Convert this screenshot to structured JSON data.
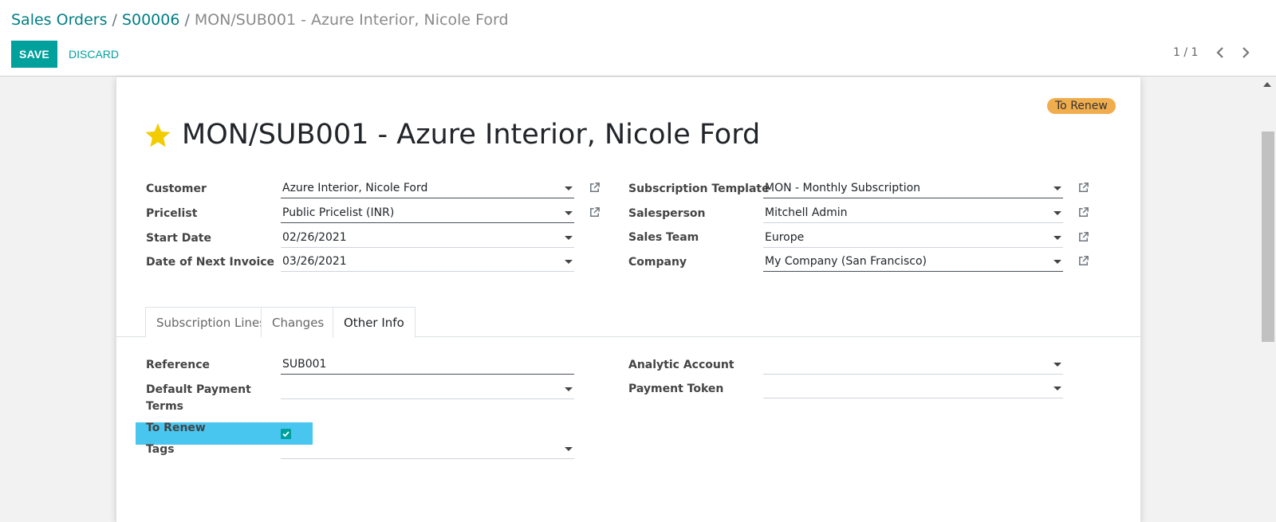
{
  "breadcrumb": {
    "root": "Sales Orders",
    "parent": "S00006",
    "current": "MON/SUB001 - Azure Interior, Nicole Ford",
    "separator": "/"
  },
  "toolbar": {
    "save_label": "SAVE",
    "discard_label": "DISCARD"
  },
  "pager": {
    "value": "1 / 1"
  },
  "ribbon": {
    "label": "To Renew",
    "color": "#f0ad4e"
  },
  "record": {
    "title": "MON/SUB001 - Azure Interior, Nicole Ford",
    "starred": true
  },
  "fields_left": [
    {
      "label": "Customer",
      "value": "Azure Interior, Nicole Ford"
    },
    {
      "label": "Pricelist",
      "value": "Public Pricelist (INR)"
    },
    {
      "label": "Start Date",
      "value": "02/26/2021"
    },
    {
      "label": "Date of Next Invoice",
      "value": "03/26/2021"
    }
  ],
  "fields_right": [
    {
      "label": "Subscription Template",
      "value": "MON - Monthly Subscription"
    },
    {
      "label": "Salesperson",
      "value": "Mitchell Admin"
    },
    {
      "label": "Sales Team",
      "value": "Europe"
    },
    {
      "label": "Company",
      "value": "My Company (San Francisco)"
    }
  ],
  "tabs": [
    {
      "label": "Subscription Lines",
      "active": false
    },
    {
      "label": "Changes",
      "active": false
    },
    {
      "label": "Other Info",
      "active": true
    }
  ],
  "other_info_left": [
    {
      "label": "Reference",
      "value": "SUB001"
    },
    {
      "label": "Default Payment",
      "label_line2": "Terms",
      "value": ""
    },
    {
      "label": "To Renew",
      "checked": true
    },
    {
      "label": "Tags",
      "value": ""
    }
  ],
  "other_info_right": [
    {
      "label": "Analytic Account",
      "value": ""
    },
    {
      "label": "Payment Token",
      "value": ""
    }
  ],
  "colors": {
    "primary": "#00a09d",
    "link": "#017e84",
    "highlight": "#48c6f0",
    "star": "#f3cc00"
  },
  "icons": [
    "star-icon",
    "external-link-icon",
    "chevron-left-icon",
    "chevron-right-icon",
    "caret-down-icon",
    "check-icon"
  ]
}
